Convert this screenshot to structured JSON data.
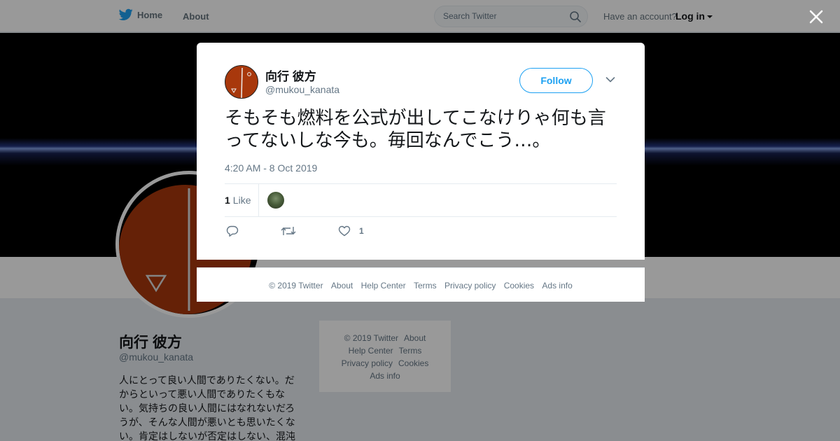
{
  "topbar": {
    "home_label": "Home",
    "about_label": "About",
    "search_placeholder": "Search Twitter",
    "account_prompt": "Have an account?",
    "login_label": "Log in"
  },
  "profile": {
    "name": "向行 彼方",
    "handle": "@mukou_kanata",
    "bio": "人にとって良い人間でありたくない。だからといって悪い人間でありたくもない。気持ちの良い人間にはなれないだろうが、そんな人間が悪いとも思いたくない。肯定はしないが否定はしない、混沌"
  },
  "side_footer": {
    "items": [
      "© 2019 Twitter",
      "About",
      "Help Center",
      "Terms",
      "Privacy policy",
      "Cookies",
      "Ads info"
    ]
  },
  "tweet": {
    "author_name": "向行 彼方",
    "author_handle": "@mukou_kanata",
    "follow_label": "Follow",
    "text": "そもそも燃料を公式が出してこなけりゃ何も言ってないしな今も。毎回なんでこう…。",
    "timestamp": "4:20 AM - 8 Oct 2019",
    "like_count": "1",
    "like_label": "Like",
    "action_like_count": "1"
  },
  "modal_footer": {
    "items": [
      "© 2019 Twitter",
      "About",
      "Help Center",
      "Terms",
      "Privacy policy",
      "Cookies",
      "Ads info"
    ]
  },
  "colors": {
    "accent": "#1da1f2",
    "avatar_orange": "#a8380c",
    "muted_text": "#657786"
  },
  "icons": {
    "logo": "twitter-bird-icon",
    "search": "search-icon",
    "close": "close-icon",
    "more": "chevron-down-icon",
    "reply": "reply-icon",
    "retweet": "retweet-icon",
    "like": "heart-icon"
  }
}
